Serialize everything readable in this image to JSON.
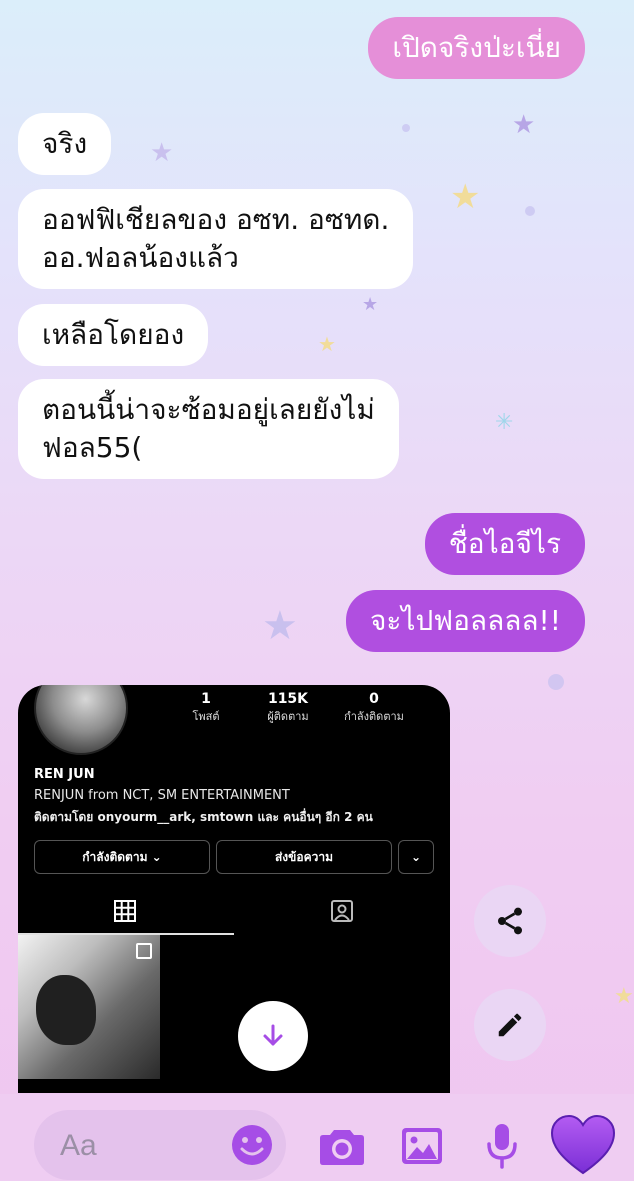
{
  "messages": [
    {
      "text": "เปิดจริงป่ะเนี่ย",
      "dir": "out"
    },
    {
      "text": "จริง",
      "dir": "in"
    },
    {
      "text": "ออฟฟิเชียลของ อซท. อซทด.\nออ.ฟอลน้องแล้ว",
      "dir": "in"
    },
    {
      "text": "เหลือโดยอง",
      "dir": "in"
    },
    {
      "text": "ตอนนี้น่าจะซ้อมอยู่เลยยังไม่\nฟอล55(",
      "dir": "in"
    },
    {
      "text": "ชื่อไอจีไร",
      "dir": "out"
    },
    {
      "text": "จะไปฟอลลลล!!",
      "dir": "out"
    }
  ],
  "shared_profile": {
    "stats": [
      {
        "value": "1",
        "label": "โพสต์"
      },
      {
        "value": "115K",
        "label": "ผู้ติดตาม"
      },
      {
        "value": "0",
        "label": "กำลังติดตาม"
      }
    ],
    "name": "REN JUN",
    "bio": "RENJUN from NCT, SM ENTERTAINMENT",
    "followed_by": "ติดตามโดย onyourm__ark, smtown และ คนอื่นๆ อีก 2 คน",
    "following_button": "กำลังติดตาม ⌄",
    "message_button": "ส่งข้อความ",
    "more_button": "⌄"
  },
  "composer": {
    "placeholder": "Aa"
  },
  "colors": {
    "accent": "#a64de6",
    "incoming_bubble": "#ffffff",
    "outgoing_pink": "#e58fd8",
    "outgoing_purple": "#b04fe0"
  },
  "icons": [
    "share-icon",
    "edit-icon",
    "download-arrow-icon",
    "emoji-icon",
    "camera-icon",
    "gallery-icon",
    "microphone-icon",
    "heart-icon",
    "grid-icon",
    "tagged-icon"
  ]
}
